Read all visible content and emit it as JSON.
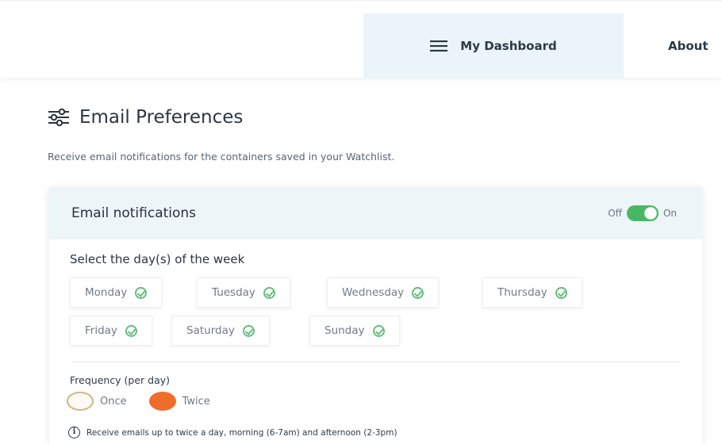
{
  "nav": {
    "dashboard_label": "My Dashboard",
    "dashboard_icon": "menu-icon",
    "about_label": "About"
  },
  "section": {
    "icon": "sliders-icon",
    "title": "Email Preferences",
    "description": "Receive email notifications for the containers saved in your Watchlist."
  },
  "card": {
    "title": "Email notifications",
    "toggle": {
      "off_label": "Off",
      "on_label": "On",
      "state": "on",
      "color": "#48b765"
    },
    "days_label": "Select the day(s) of the week",
    "days": [
      {
        "label": "Monday",
        "selected": true
      },
      {
        "label": "Tuesday",
        "selected": true
      },
      {
        "label": "Wednesday",
        "selected": true
      },
      {
        "label": "Thursday",
        "selected": true
      },
      {
        "label": "Friday",
        "selected": true
      },
      {
        "label": "Saturday",
        "selected": true
      },
      {
        "label": "Sunday",
        "selected": true
      }
    ],
    "frequency": {
      "label": "Frequency (per day)",
      "options": [
        {
          "label": "Once",
          "selected": false
        },
        {
          "label": "Twice",
          "selected": true
        }
      ],
      "accent": "#ef6d2a"
    },
    "info_text": "Receive emails up to twice a day, morning (6-7am) and afternoon (2-3pm)"
  }
}
